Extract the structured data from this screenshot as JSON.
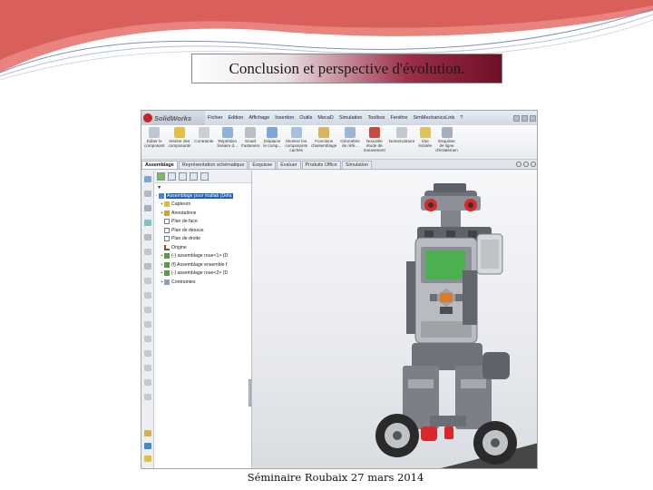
{
  "slide": {
    "title": "Conclusion et perspective d'évolution.",
    "footer": "Séminaire Roubaix 27 mars 2014"
  },
  "app": {
    "logo": "SolidWorks",
    "menu": [
      "Fichier",
      "Edition",
      "Affichage",
      "Insertion",
      "Outils",
      "MecaD",
      "Simulation",
      "Toolbox",
      "Fenêtre",
      "SimMechanicsLink",
      "?"
    ],
    "ribbon": [
      {
        "label": "Editer le\ncomposant"
      },
      {
        "label": "Insérer des\ncomposants"
      },
      {
        "label": "Contrainte"
      },
      {
        "label": "Répétition\nlinéaire d..."
      },
      {
        "label": "Smart\nFasteners"
      },
      {
        "label": "Déplacer\nle comp..."
      },
      {
        "label": "Montrer les\ncomposants\ncachés"
      },
      {
        "label": "Fonctions\nd'assemblage"
      },
      {
        "label": "Géométrie\nde réfé..."
      },
      {
        "label": "Nouvelle\nétude de\nmouvement"
      },
      {
        "label": "Nomenclature"
      },
      {
        "label": "Vue\néclatée"
      },
      {
        "label": "Esquisse\nde ligne\nd'éclatemen"
      }
    ],
    "tabs": [
      "Assemblage",
      "Représentation schématique",
      "Esquisse",
      "Evaluer",
      "Produits Office",
      "Simulation"
    ],
    "active_tab": "Assemblage",
    "tree": {
      "filter": "▼",
      "items": [
        {
          "text": "Assemblage pour matlab (Défa",
          "expander": "-",
          "selected": true
        },
        {
          "text": "Capteurs",
          "expander": "+"
        },
        {
          "text": "Annotations",
          "expander": "+"
        },
        {
          "text": "Plan de face",
          "expander": ""
        },
        {
          "text": "Plan de dessus",
          "expander": ""
        },
        {
          "text": "Plan de droite",
          "expander": ""
        },
        {
          "text": "Origine",
          "expander": ""
        },
        {
          "text": "(-) assemblage roue<1> (D",
          "expander": "+"
        },
        {
          "text": "(f) Assemblage ensemble f",
          "expander": "+"
        },
        {
          "text": "(-) assemblage roue<2> (D",
          "expander": "+"
        },
        {
          "text": "Contraintes",
          "expander": "+"
        }
      ]
    },
    "colors": {
      "brand_red": "#c5241f",
      "selection": "#1f5fbf",
      "lcd_green": "#4caf50",
      "nxt_grey": "#9ea3a8",
      "wheel_red": "#d8282c"
    }
  }
}
